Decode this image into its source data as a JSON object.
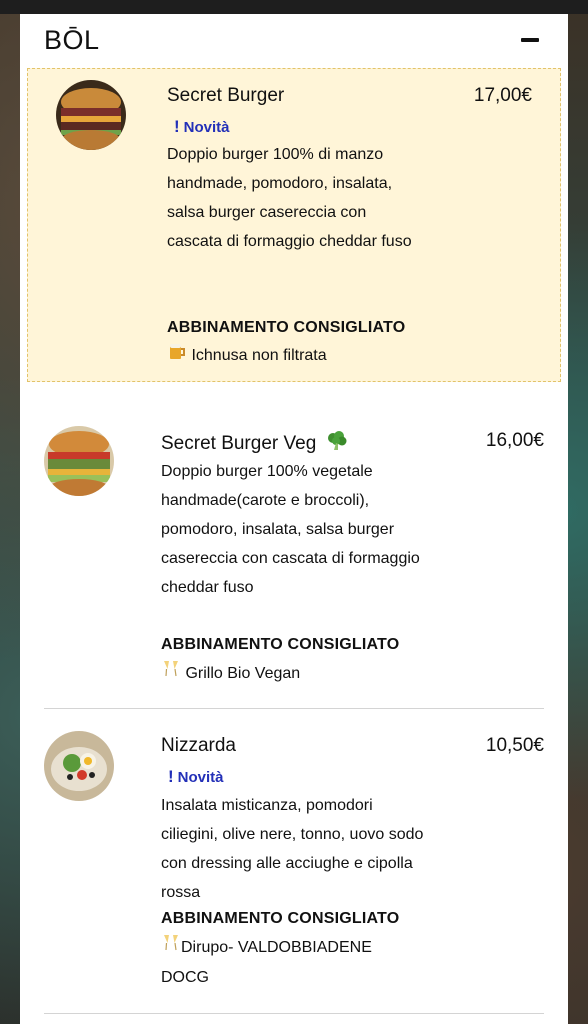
{
  "section": {
    "title": "BŌL",
    "collapse_label": "−"
  },
  "items": [
    {
      "name": "Secret Burger",
      "price": "17,00€",
      "badge": "Novità",
      "description": "Doppio burger 100% di manzo handmade, pomodoro, insalata, salsa burger casereccia con cascata di formaggio cheddar fuso",
      "pairing_title": "ABBINAMENTO CONSIGLIATO",
      "pairing": "Ichnusa non filtrata",
      "highlighted": true
    },
    {
      "name": "Secret Burger Veg",
      "price": "16,00€",
      "description": "Doppio burger 100% vegetale handmade(carote e broccoli), pomodoro, insalata, salsa burger casereccia con cascata di formaggio cheddar fuso",
      "pairing_title": "ABBINAMENTO CONSIGLIATO",
      "pairing": "Grillo Bio Vegan",
      "highlighted": false
    },
    {
      "name": "Nizzarda",
      "price": "10,50€",
      "badge": "Novità",
      "description": "Insalata misticanza, pomodori ciliegini, olive nere, tonno, uovo sodo con dressing alle acciughe e cipolla rossa",
      "pairing_title": "ABBINAMENTO CONSIGLIATO",
      "pairing": "Dirupo- VALDOBBIADENE DOCG",
      "highlighted": false
    }
  ],
  "colors": {
    "highlight_bg": "#fff5d8",
    "highlight_border": "#e2c36a",
    "badge": "#2330b8"
  },
  "icons": {
    "beer": "beer-mug-icon",
    "broccoli": "broccoli-icon",
    "champagne": "champagne-glasses-icon",
    "new": "exclamation-icon"
  }
}
